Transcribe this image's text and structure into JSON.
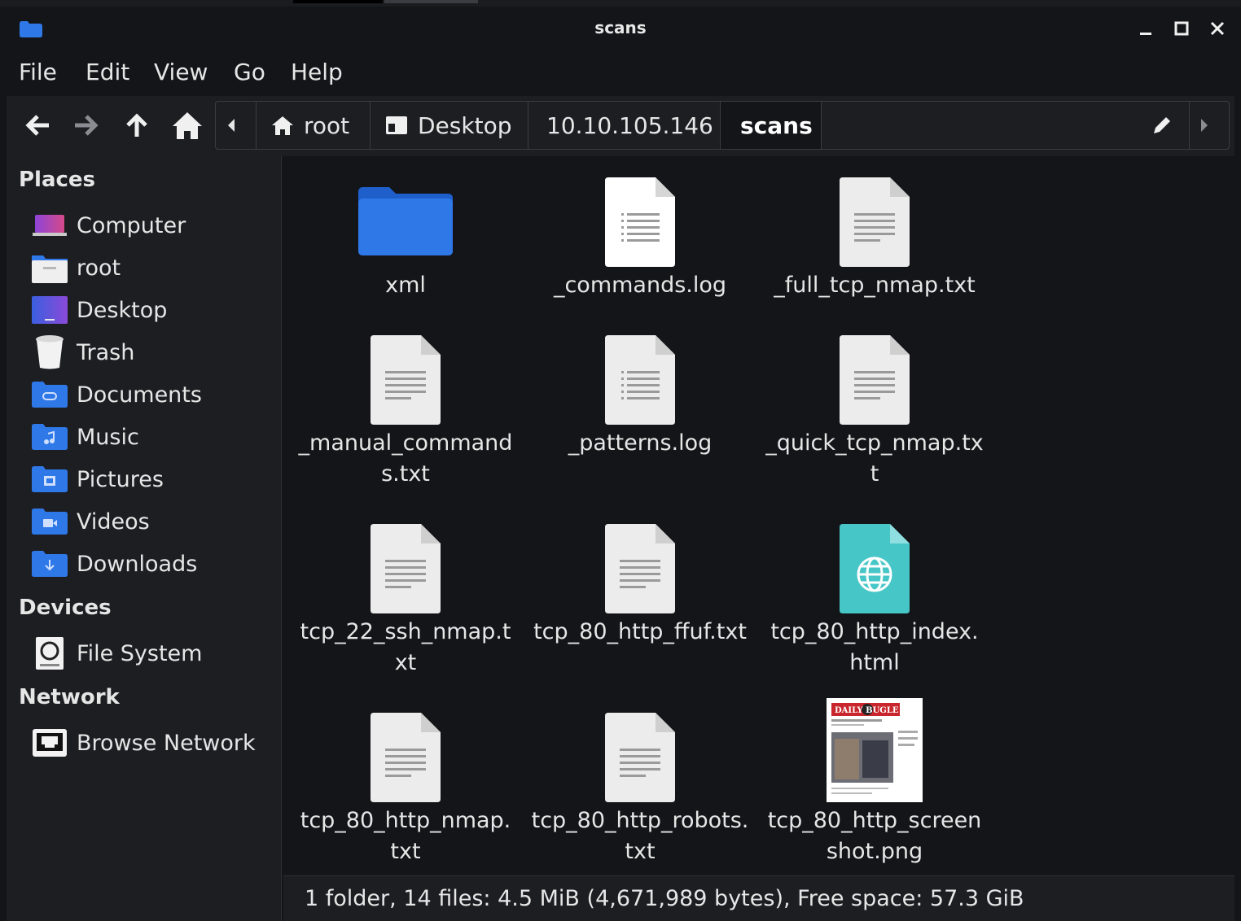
{
  "window": {
    "title": "scans"
  },
  "menu": [
    "File",
    "Edit",
    "View",
    "Go",
    "Help"
  ],
  "path": {
    "crumbs": [
      {
        "label": "root",
        "icon": "home-icon"
      },
      {
        "label": "Desktop",
        "icon": "desktop-icon"
      },
      {
        "label": "10.10.105.146",
        "icon": ""
      },
      {
        "label": "scans",
        "icon": ""
      }
    ]
  },
  "sidebar": {
    "sections": [
      {
        "title": "Places",
        "items": [
          {
            "label": "Computer",
            "icon": "computer-icon"
          },
          {
            "label": "root",
            "icon": "home-folder-icon"
          },
          {
            "label": "Desktop",
            "icon": "desktop-icon"
          },
          {
            "label": "Trash",
            "icon": "trash-icon"
          },
          {
            "label": "Documents",
            "icon": "documents-folder-icon"
          },
          {
            "label": "Music",
            "icon": "music-folder-icon"
          },
          {
            "label": "Pictures",
            "icon": "pictures-folder-icon"
          },
          {
            "label": "Videos",
            "icon": "videos-folder-icon"
          },
          {
            "label": "Downloads",
            "icon": "downloads-folder-icon"
          }
        ]
      },
      {
        "title": "Devices",
        "items": [
          {
            "label": "File System",
            "icon": "drive-icon"
          }
        ]
      },
      {
        "title": "Network",
        "items": [
          {
            "label": "Browse Network",
            "icon": "network-icon"
          }
        ]
      }
    ]
  },
  "files": [
    {
      "name": "xml",
      "type": "folder"
    },
    {
      "name": "_commands.log",
      "type": "log"
    },
    {
      "name": "_full_tcp_nmap.txt",
      "type": "text"
    },
    {
      "name": "_manual_commands.txt",
      "type": "text"
    },
    {
      "name": "_patterns.log",
      "type": "log"
    },
    {
      "name": "_quick_tcp_nmap.txt",
      "type": "text"
    },
    {
      "name": "tcp_22_ssh_nmap.txt",
      "type": "text"
    },
    {
      "name": "tcp_80_http_ffuf.txt",
      "type": "text"
    },
    {
      "name": "tcp_80_http_index.html",
      "type": "html"
    },
    {
      "name": "tcp_80_http_nmap.txt",
      "type": "text"
    },
    {
      "name": "tcp_80_http_robots.txt",
      "type": "text"
    },
    {
      "name": "tcp_80_http_screenshot.png",
      "type": "image",
      "thumb_text": "DAILY BUGLE"
    }
  ],
  "status": {
    "text": "1 folder, 14 files: 4.5 MiB (4,671,989 bytes), Free space: 57.3 GiB"
  },
  "colors": {
    "accent": "#2f78e8",
    "html_file": "#47c6c8",
    "background": "#141518",
    "panel": "#1d1e22"
  }
}
